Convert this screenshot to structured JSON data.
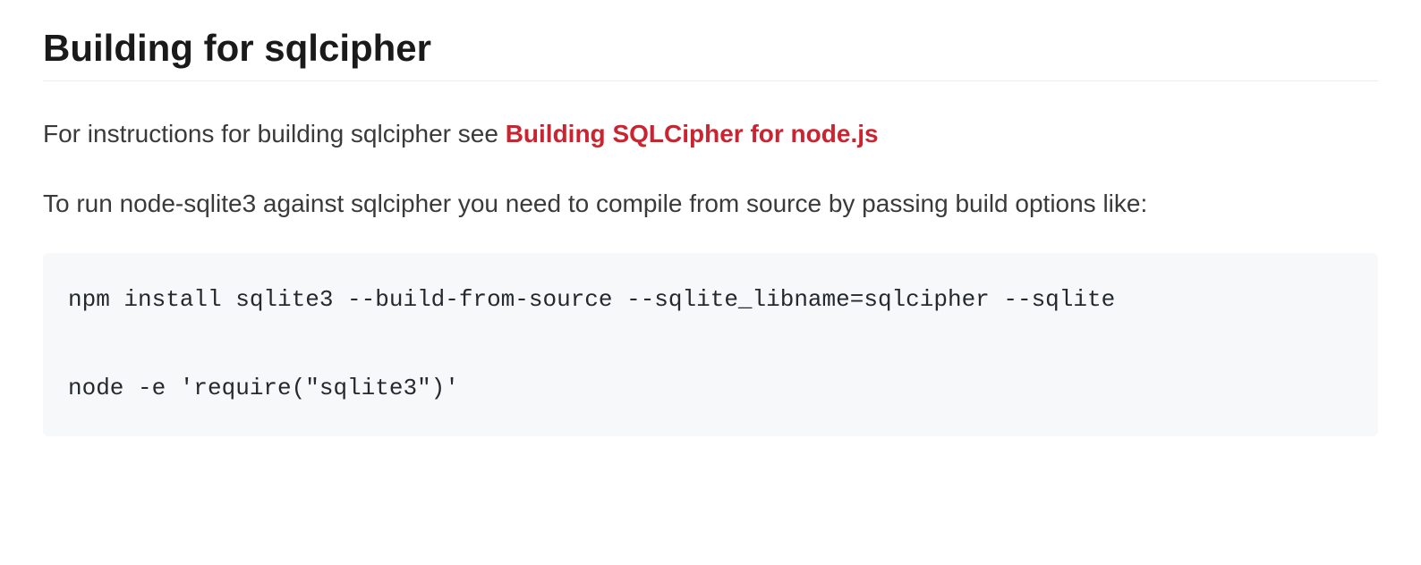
{
  "heading": "Building for sqlcipher",
  "paragraph1_prefix": "For instructions for building sqlcipher see ",
  "paragraph1_link": "Building SQLCipher for node.js",
  "paragraph2": "To run node-sqlite3 against sqlcipher you need to compile from source by passing build options like:",
  "code_block": "npm install sqlite3 --build-from-source --sqlite_libname=sqlcipher --sqlite\n\nnode -e 'require(\"sqlite3\")'"
}
